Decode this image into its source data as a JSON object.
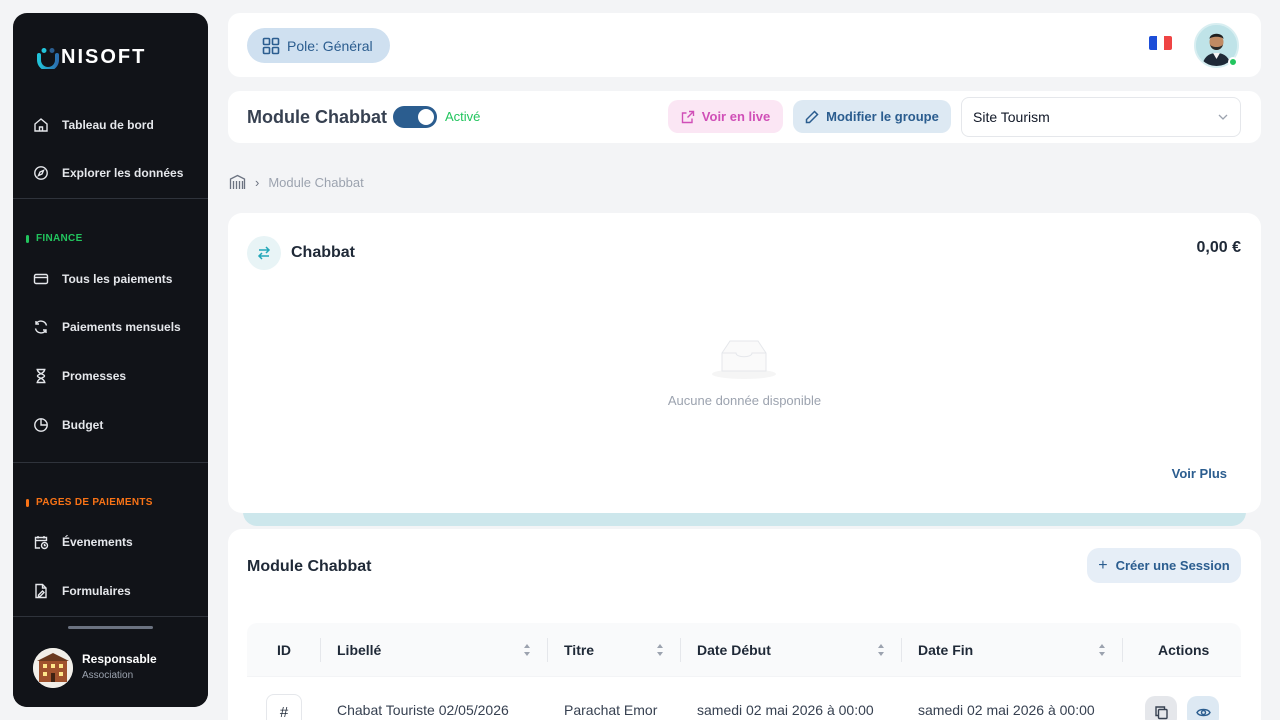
{
  "brand": {
    "logo_text": "NISOFT"
  },
  "sidebar": {
    "main_items": [
      {
        "label": "Tableau de bord",
        "icon": "home-icon"
      },
      {
        "label": "Explorer les données",
        "icon": "compass-icon"
      }
    ],
    "sections": [
      {
        "title": "FINANCE",
        "color": "#22c55e",
        "items": [
          {
            "label": "Tous les paiements",
            "icon": "credit-card-icon"
          },
          {
            "label": "Paiements mensuels",
            "icon": "refresh-icon"
          },
          {
            "label": "Promesses",
            "icon": "hourglass-icon"
          },
          {
            "label": "Budget",
            "icon": "pie-chart-icon"
          }
        ]
      },
      {
        "title": "PAGES DE PAIEMENTS",
        "color": "#f97316",
        "items": [
          {
            "label": "Évenements",
            "icon": "calendar-clock-icon"
          },
          {
            "label": "Formulaires",
            "icon": "form-icon"
          }
        ]
      }
    ],
    "user": {
      "name": "Responsable",
      "role": "Association"
    }
  },
  "header": {
    "pole_label": "Pole: Général",
    "language_flag": "fr"
  },
  "module_bar": {
    "title": "Module Chabbat",
    "toggle_label": "Activé",
    "toggle_on": true,
    "live_label": "Voir en live",
    "edit_label": "Modifier le groupe",
    "site_select_value": "Site Tourism"
  },
  "breadcrumb": {
    "current": "Module Chabbat"
  },
  "summary_card": {
    "title": "Chabbat",
    "amount": "0,00 €",
    "empty_text": "Aucune donnée disponible",
    "more_label": "Voir Plus"
  },
  "sessions": {
    "title": "Module Chabbat",
    "create_label": "Créer une Session",
    "columns": [
      "ID",
      "Libellé",
      "Titre",
      "Date Début",
      "Date Fin",
      "Actions"
    ],
    "rows": [
      {
        "id": "#",
        "libelle": "Chabat Touriste 02/05/2026",
        "titre": "Parachat Emor",
        "date_debut": "samedi 02 mai 2026 à 00:00",
        "date_fin": "samedi 02 mai 2026 à 00:00"
      }
    ]
  },
  "colors": {
    "primary": "#2b5d8f",
    "success": "#22c55e",
    "sidebar_bg": "#111318"
  }
}
